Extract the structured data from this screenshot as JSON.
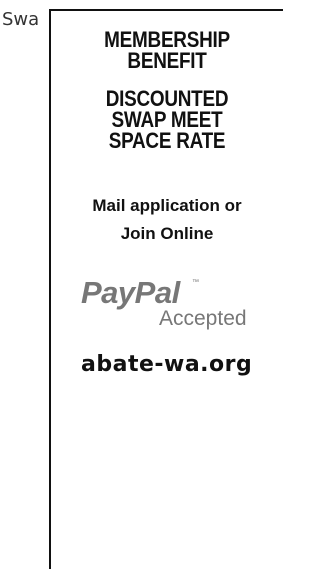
{
  "left_fragment": "Swa",
  "panel": {
    "headline_1_line1": "MEMBERSHIP",
    "headline_1_line2": "BENEFIT",
    "headline_2_line1": "DISCOUNTED",
    "headline_2_line2": "SWAP MEET",
    "headline_2_line3": "SPACE RATE",
    "mail_line1": "Mail application or",
    "mail_line2": "Join Online",
    "paypal_logo_text": "PayPal",
    "paypal_tm": "™",
    "paypal_accepted": "Accepted",
    "website": "abate-wa.org"
  }
}
